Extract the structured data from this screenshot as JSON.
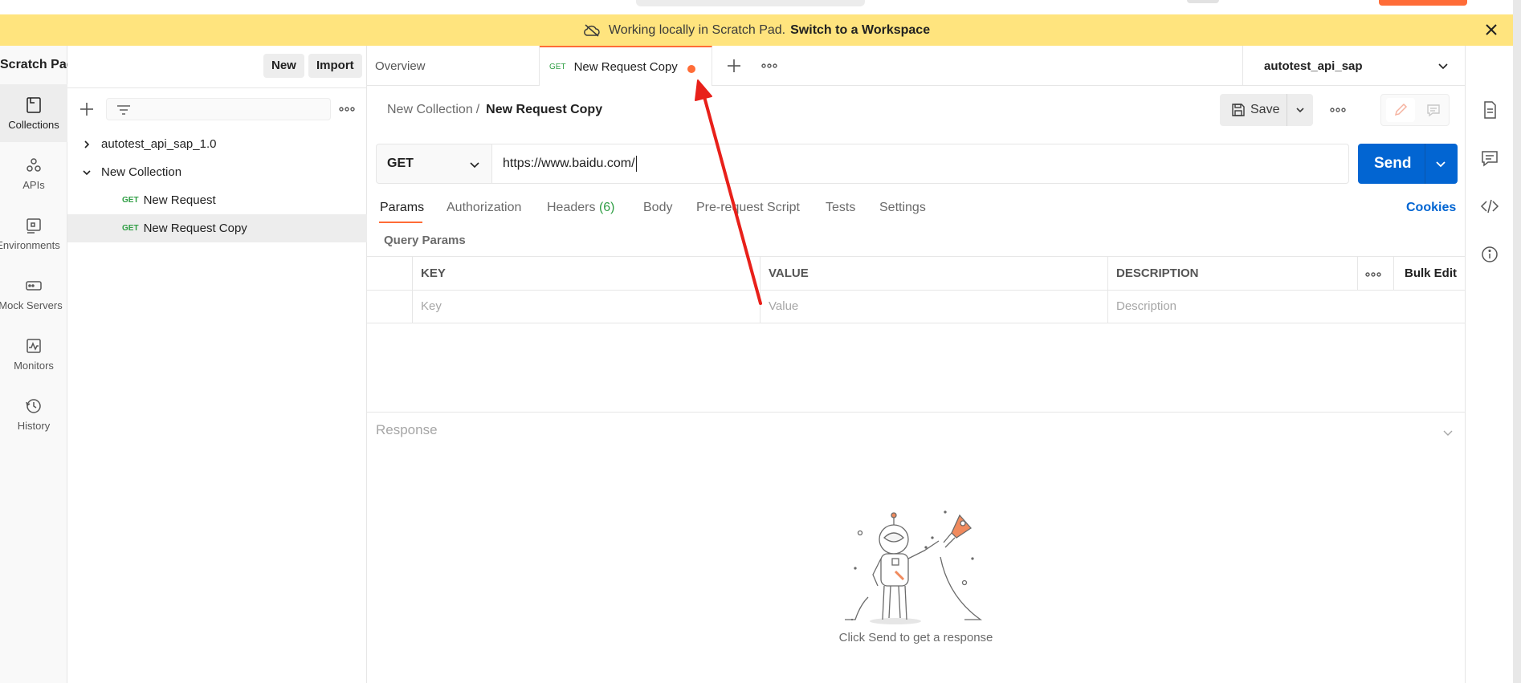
{
  "banner": {
    "message": "Working locally in Scratch Pad.",
    "link": "Switch to a Workspace"
  },
  "workspace": {
    "title": "Scratch Pad",
    "new_label": "New",
    "import_label": "Import"
  },
  "rail": {
    "items": [
      {
        "label": "Collections",
        "icon": "collections-icon"
      },
      {
        "label": "APIs",
        "icon": "apis-icon"
      },
      {
        "label": "Environments",
        "icon": "environments-icon"
      },
      {
        "label": "Mock Servers",
        "icon": "mock-servers-icon"
      },
      {
        "label": "Monitors",
        "icon": "monitors-icon"
      },
      {
        "label": "History",
        "icon": "history-icon"
      }
    ]
  },
  "tree": {
    "items": [
      {
        "label": "autotest_api_sap_1.0",
        "expanded": false
      },
      {
        "label": "New Collection",
        "expanded": true
      },
      {
        "method": "GET",
        "label": "New Request"
      },
      {
        "method": "GET",
        "label": "New Request Copy",
        "selected": true
      }
    ]
  },
  "tabs": {
    "overview": "Overview",
    "active": {
      "method": "GET",
      "label": "New Request Copy",
      "unsaved": true
    }
  },
  "environment": {
    "selected": "autotest_api_sap"
  },
  "request": {
    "breadcrumb_parent": "New Collection",
    "breadcrumb_sep": "/",
    "breadcrumb_current": "New Request Copy",
    "save_label": "Save",
    "method": "GET",
    "url": "https://www.baidu.com/",
    "send_label": "Send"
  },
  "request_tabs": {
    "params": "Params",
    "authorization": "Authorization",
    "headers": "Headers",
    "headers_count": "(6)",
    "body": "Body",
    "prerequest": "Pre-request Script",
    "tests": "Tests",
    "settings": "Settings",
    "cookies": "Cookies"
  },
  "params": {
    "section_label": "Query Params",
    "columns": [
      "KEY",
      "VALUE",
      "DESCRIPTION"
    ],
    "bulk_edit": "Bulk Edit",
    "placeholders": [
      "Key",
      "Value",
      "Description"
    ]
  },
  "response": {
    "title": "Response",
    "empty_message": "Click Send to get a response"
  },
  "colors": {
    "accent": "#ff6c37",
    "primary": "#0265d2",
    "banner": "#ffe47e",
    "method_get": "#2f9e44",
    "annotation": "#e8201a"
  }
}
